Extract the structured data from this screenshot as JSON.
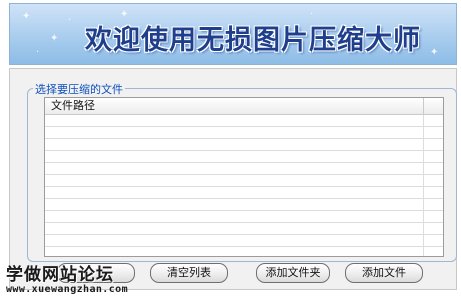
{
  "banner": {
    "title": "欢迎使用无损图片压缩大师"
  },
  "file_group": {
    "legend": "选择要压缩的文件",
    "columns": [
      "文件路径"
    ],
    "rows": []
  },
  "buttons": {
    "clear_list": "清空列表",
    "add_folder": "添加文件夹",
    "add_file": "添加文件"
  },
  "watermark": {
    "title": "学做网站论坛",
    "url": "www.xuewangzhan.com"
  },
  "colors": {
    "banner_title": "#1f3f8c",
    "group_legend": "#0d4fbd",
    "window_bg": "#f1f1f1"
  }
}
